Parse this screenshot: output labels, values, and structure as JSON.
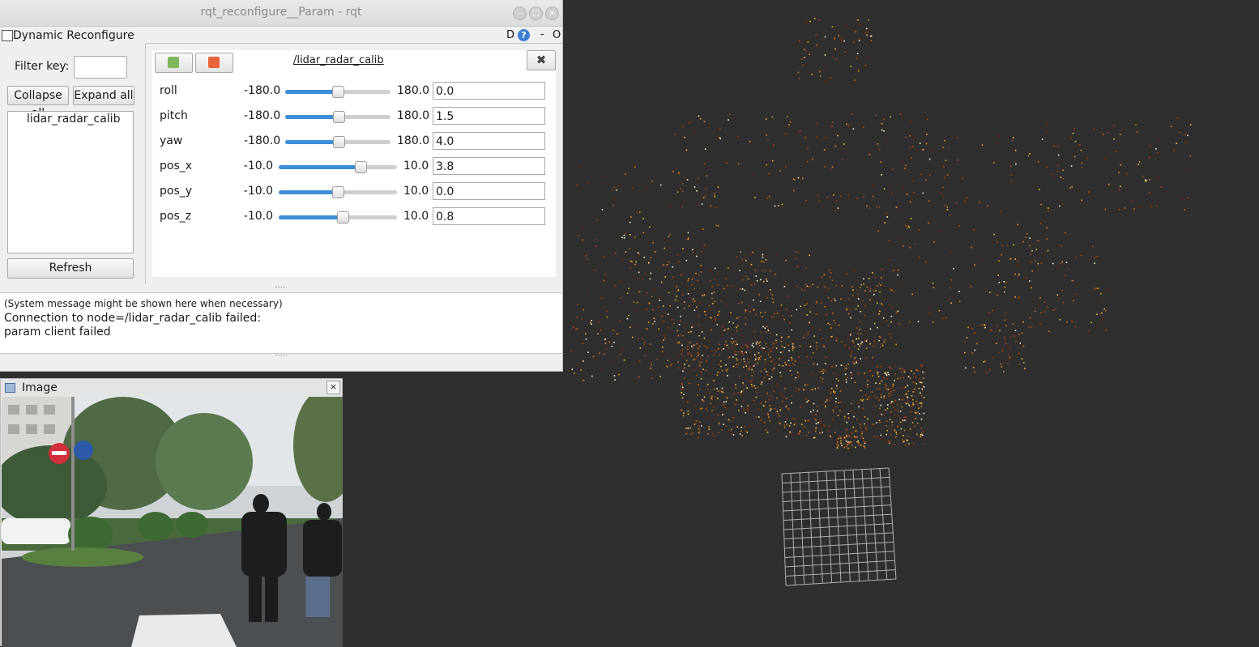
{
  "window": {
    "title": "rqt_reconfigure__Param - rqt",
    "minimize_glyph": "–",
    "maximize_glyph": "□",
    "close_glyph": "×"
  },
  "plugin": {
    "title": "Dynamic Reconfigure",
    "d_label": "D",
    "help_label": "?",
    "dash_label": "-",
    "o_label": "O"
  },
  "left": {
    "filter_label": "Filter key:",
    "filter_value": "",
    "collapse_label": "Collapse all",
    "expand_label": "Expand all",
    "tree_items": [
      "lidar_radar_calib"
    ],
    "refresh_label": "Refresh"
  },
  "node": {
    "name": "/lidar_radar_calib",
    "close_glyph": "✖",
    "save_icon": "download-icon",
    "load_icon": "folder-open-icon"
  },
  "params": [
    {
      "name": "roll",
      "min": "-180.0",
      "max": "180.0",
      "value": "0.0",
      "fraction": 0.5
    },
    {
      "name": "pitch",
      "min": "-180.0",
      "max": "180.0",
      "value": "1.5",
      "fraction": 0.504
    },
    {
      "name": "yaw",
      "min": "-180.0",
      "max": "180.0",
      "value": "4.0",
      "fraction": 0.511
    },
    {
      "name": "pos_x",
      "min": "-10.0",
      "max": "10.0",
      "value": "3.8",
      "fraction": 0.69
    },
    {
      "name": "pos_y",
      "min": "-10.0",
      "max": "10.0",
      "value": "0.0",
      "fraction": 0.5
    },
    {
      "name": "pos_z",
      "min": "-10.0",
      "max": "10.0",
      "value": "0.8",
      "fraction": 0.54
    }
  ],
  "messages": {
    "hint": "(System message might be shown here when necessary)",
    "line1": "Connection to node=/lidar_radar_calib failed:",
    "line2": "param client failed"
  },
  "image_window": {
    "title": "Image",
    "close_glyph": "×"
  },
  "colors": {
    "slider_fill": "#3c8fd8",
    "viz_background": "#2f2f2f",
    "grid": "#b0b0b0"
  }
}
